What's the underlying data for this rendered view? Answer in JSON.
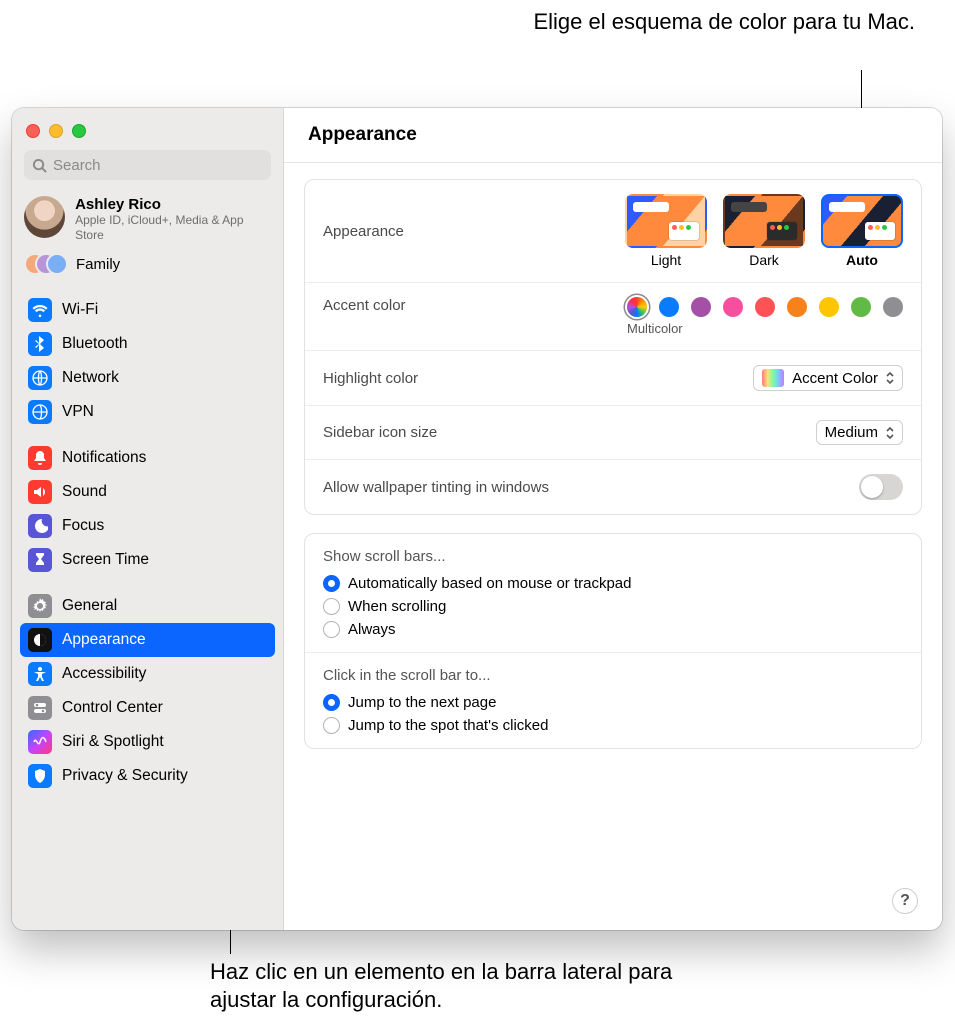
{
  "callouts": {
    "top": "Elige el esquema de color para tu Mac.",
    "bottom": "Haz clic en un elemento en la barra lateral para ajustar la configuración."
  },
  "search": {
    "placeholder": "Search"
  },
  "user": {
    "name": "Ashley Rico",
    "sub": "Apple ID, iCloud+, Media & App Store"
  },
  "family": {
    "label": "Family"
  },
  "nav1": [
    {
      "label": "Wi-Fi",
      "icon": "wifi",
      "cls": "ic-blue"
    },
    {
      "label": "Bluetooth",
      "icon": "bluetooth",
      "cls": "ic-blue"
    },
    {
      "label": "Network",
      "icon": "network",
      "cls": "ic-blue"
    },
    {
      "label": "VPN",
      "icon": "vpn",
      "cls": "ic-blue"
    }
  ],
  "nav2": [
    {
      "label": "Notifications",
      "icon": "bell",
      "cls": "ic-red"
    },
    {
      "label": "Sound",
      "icon": "sound",
      "cls": "ic-red"
    },
    {
      "label": "Focus",
      "icon": "moon",
      "cls": "ic-purple"
    },
    {
      "label": "Screen Time",
      "icon": "hourglass",
      "cls": "ic-purple"
    }
  ],
  "nav3": [
    {
      "label": "General",
      "icon": "gear",
      "cls": "ic-gray"
    },
    {
      "label": "Appearance",
      "icon": "appearance",
      "cls": "ic-black",
      "selected": true
    },
    {
      "label": "Accessibility",
      "icon": "accessibility",
      "cls": "ic-blue"
    },
    {
      "label": "Control Center",
      "icon": "control",
      "cls": "ic-gray"
    },
    {
      "label": "Siri & Spotlight",
      "icon": "siri",
      "cls": "ic-siri"
    },
    {
      "label": "Privacy & Security",
      "icon": "hand",
      "cls": "ic-blue"
    }
  ],
  "header": {
    "title": "Appearance"
  },
  "appearance": {
    "label": "Appearance",
    "options": [
      {
        "label": "Light",
        "sel": false,
        "kind": "light"
      },
      {
        "label": "Dark",
        "sel": false,
        "kind": "dark"
      },
      {
        "label": "Auto",
        "sel": true,
        "kind": "auto"
      }
    ]
  },
  "accent": {
    "label": "Accent color",
    "caption": "Multicolor",
    "colors": [
      "multi",
      "#0a7bff",
      "#a550a7",
      "#f74f9e",
      "#ff5257",
      "#f7821b",
      "#ffc600",
      "#62ba46",
      "#8e8e93"
    ],
    "selected": 0
  },
  "highlight": {
    "label": "Highlight color",
    "value": "Accent Color"
  },
  "sidebarSize": {
    "label": "Sidebar icon size",
    "value": "Medium"
  },
  "tinting": {
    "label": "Allow wallpaper tinting in windows",
    "on": false
  },
  "scrollbars": {
    "label": "Show scroll bars...",
    "options": [
      "Automatically based on mouse or trackpad",
      "When scrolling",
      "Always"
    ],
    "selected": 0
  },
  "scrollclick": {
    "label": "Click in the scroll bar to...",
    "options": [
      "Jump to the next page",
      "Jump to the spot that's clicked"
    ],
    "selected": 0
  },
  "help": "?"
}
